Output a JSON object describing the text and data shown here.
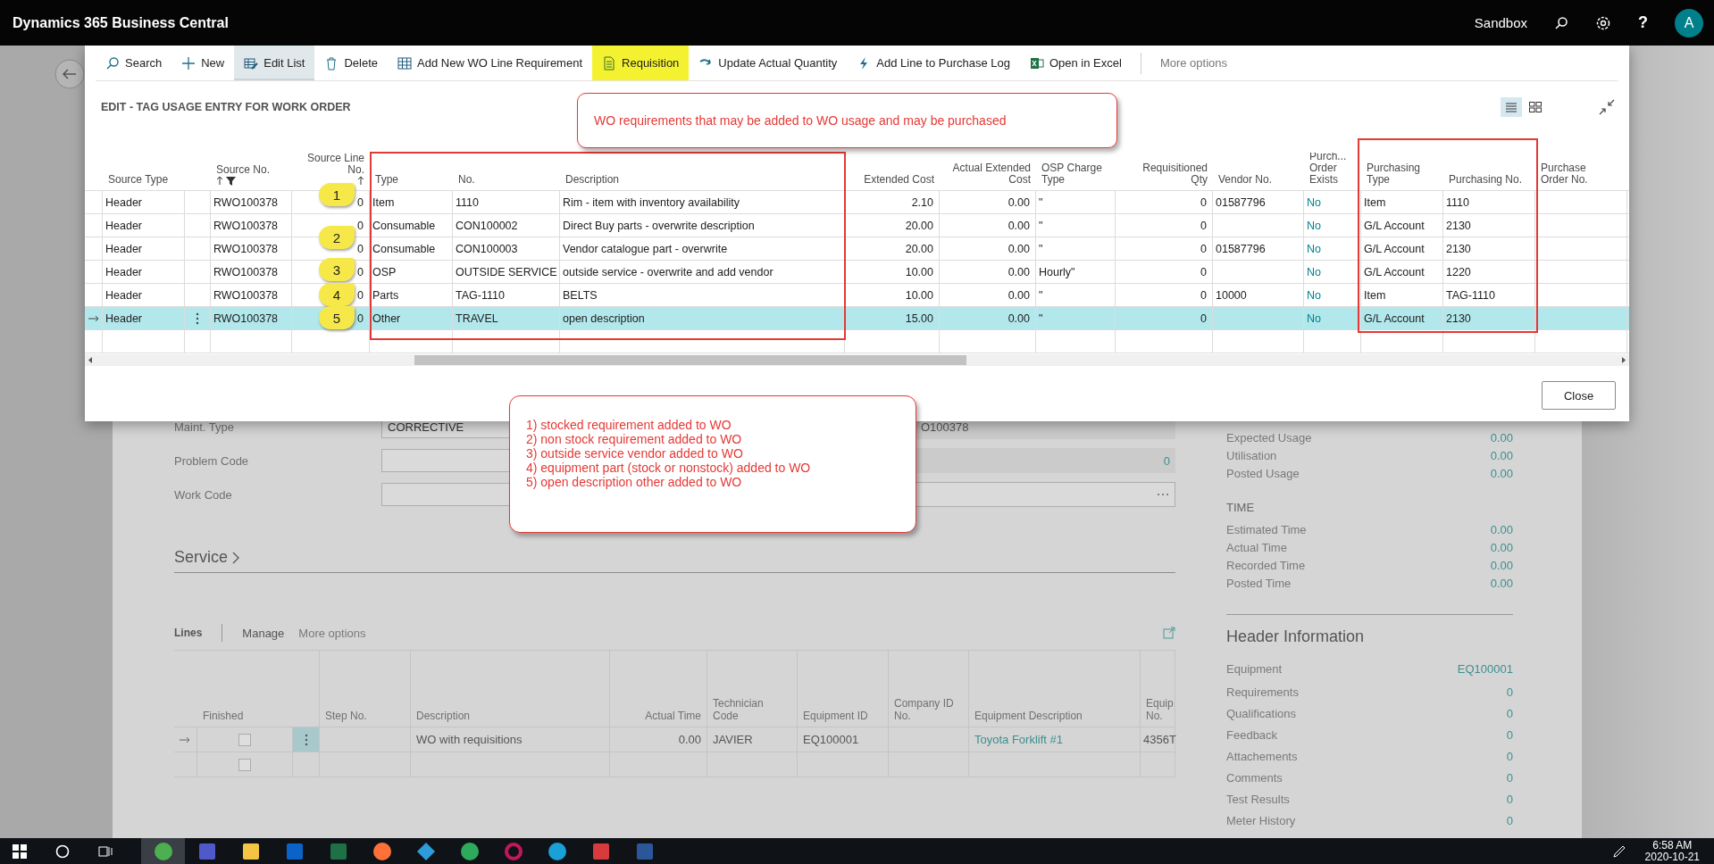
{
  "top_bar": {
    "title": "Dynamics 365 Business Central",
    "environment": "Sandbox",
    "help": "?",
    "avatar": "A"
  },
  "dialog": {
    "toolbar": [
      {
        "label": "Search",
        "selected": false,
        "highlighted": false
      },
      {
        "label": "New",
        "selected": false,
        "highlighted": false
      },
      {
        "label": "Edit List",
        "selected": true,
        "highlighted": false
      },
      {
        "label": "Delete",
        "selected": false,
        "highlighted": false
      },
      {
        "label": "Add New WO Line Requirement",
        "selected": false,
        "highlighted": false
      },
      {
        "label": "Requisition",
        "selected": false,
        "highlighted": true
      },
      {
        "label": "Update Actual Quantity",
        "selected": false,
        "highlighted": false
      },
      {
        "label": "Add Line to Purchase Log",
        "selected": false,
        "highlighted": false
      },
      {
        "label": "Open in Excel",
        "selected": false,
        "highlighted": false
      }
    ],
    "more_options": "More options",
    "title": "EDIT - TAG USAGE ENTRY FOR WORK ORDER",
    "columns": [
      {
        "lines": [
          "Source Type"
        ],
        "sorted": false,
        "filtered": false
      },
      {
        "lines": [
          "Source No."
        ],
        "sorted": true,
        "filtered": true
      },
      {
        "lines": [
          "Source Line",
          "No."
        ],
        "sorted": true,
        "filtered": false
      },
      {
        "lines": [
          "Type"
        ],
        "sorted": false,
        "filtered": false
      },
      {
        "lines": [
          "No."
        ],
        "sorted": false,
        "filtered": false
      },
      {
        "lines": [
          "Description"
        ],
        "sorted": false,
        "filtered": false
      },
      {
        "lines": [
          "Extended Cost"
        ],
        "sorted": false,
        "filtered": false
      },
      {
        "lines": [
          "Actual Extended",
          "Cost"
        ],
        "sorted": false,
        "filtered": false
      },
      {
        "lines": [
          "OSP Charge",
          "Type"
        ],
        "sorted": false,
        "filtered": false
      },
      {
        "lines": [
          "Requisitioned",
          "Qty"
        ],
        "sorted": false,
        "filtered": false
      },
      {
        "lines": [
          "Vendor No."
        ],
        "sorted": false,
        "filtered": false
      },
      {
        "lines": [
          "Purch...",
          "Order",
          "Exists"
        ],
        "sorted": false,
        "filtered": false
      },
      {
        "lines": [
          "Purchasing",
          "Type"
        ],
        "sorted": false,
        "filtered": false
      },
      {
        "lines": [
          "Purchasing No."
        ],
        "sorted": false,
        "filtered": false
      },
      {
        "lines": [
          "Purchase",
          "Order No."
        ],
        "sorted": false,
        "filtered": false
      }
    ],
    "rows": [
      {
        "selected": false,
        "source_type": "Header",
        "source_no": "RWO100378",
        "line_no": "0",
        "type": "Item",
        "no": "1110",
        "description": "Rim - item with inventory availability",
        "extended_cost": "2.10",
        "actual_extended_cost": "0.00",
        "osp_charge_type": "\"",
        "requisitioned_qty": "0",
        "vendor_no": "01587796",
        "po_exists": "No",
        "purchasing_type": "Item",
        "purchasing_no": "1110"
      },
      {
        "selected": false,
        "source_type": "Header",
        "source_no": "RWO100378",
        "line_no": "0",
        "type": "Consumable",
        "no": "CON100002",
        "description": "Direct Buy parts - overwrite description",
        "extended_cost": "20.00",
        "actual_extended_cost": "0.00",
        "osp_charge_type": "\"",
        "requisitioned_qty": "0",
        "po_exists": "No",
        "purchasing_type": "G/L Account",
        "purchasing_no": "2130"
      },
      {
        "selected": false,
        "source_type": "Header",
        "source_no": "RWO100378",
        "line_no": "0",
        "type": "Consumable",
        "no": "CON100003",
        "description": "Vendor catalogue part - overwrite",
        "extended_cost": "20.00",
        "actual_extended_cost": "0.00",
        "osp_charge_type": "\"",
        "requisitioned_qty": "0",
        "vendor_no": "01587796",
        "po_exists": "No",
        "purchasing_type": "G/L Account",
        "purchasing_no": "2130"
      },
      {
        "selected": false,
        "source_type": "Header",
        "source_no": "RWO100378",
        "line_no": "0",
        "type": "OSP",
        "no": "OUTSIDE SERVICE",
        "description": "outside service - overwrite and add vendor",
        "extended_cost": "10.00",
        "actual_extended_cost": "0.00",
        "osp_charge_type": "Hourly\"",
        "requisitioned_qty": "0",
        "po_exists": "No",
        "purchasing_type": "G/L Account",
        "purchasing_no": "1220"
      },
      {
        "selected": false,
        "source_type": "Header",
        "source_no": "RWO100378",
        "line_no": "0",
        "type": "Parts",
        "no": "TAG-1110",
        "description": "BELTS",
        "extended_cost": "10.00",
        "actual_extended_cost": "0.00",
        "osp_charge_type": "\"",
        "requisitioned_qty": "0",
        "vendor_no": "10000",
        "po_exists": "No",
        "purchasing_type": "Item",
        "purchasing_no": "TAG-1110"
      },
      {
        "selected": true,
        "source_type": "Header",
        "source_no": "RWO100378",
        "line_no": "0",
        "type": "Other",
        "no": "TRAVEL",
        "description": "open description",
        "extended_cost": "15.00",
        "actual_extended_cost": "0.00",
        "osp_charge_type": "\"",
        "requisitioned_qty": "0",
        "po_exists": "No",
        "purchasing_type": "G/L Account",
        "purchasing_no": "2130"
      }
    ],
    "close": "Close"
  },
  "annotations": {
    "top_note": "WO requirements that may be added to WO usage and may be purchased",
    "list_note": [
      "1) stocked requirement added to WO",
      "2) non stock requirement added to WO",
      "3) outside service vendor added to WO",
      "4) equipment part (stock or nonstock) added to WO",
      "5) open description other added to WO"
    ],
    "markers": [
      {
        "label": "1"
      },
      {
        "label": "2"
      },
      {
        "label": "3"
      },
      {
        "label": "4"
      },
      {
        "label": "5"
      }
    ]
  },
  "page": {
    "fields": [
      {
        "label": "Maint. Type",
        "value": "CORRECTIVE",
        "kind": "text",
        "right_value": "O100378"
      },
      {
        "label": "Problem Code",
        "kind": "number",
        "right_value": "0"
      },
      {
        "label": "Work Code",
        "kind": "lookup"
      }
    ],
    "service_title": "Service",
    "lines": {
      "title": "Lines",
      "actions": [
        "Manage",
        "More options"
      ],
      "columns": [
        {
          "lines": [
            "Finished"
          ]
        },
        {
          "lines": [
            "Step No."
          ]
        },
        {
          "lines": [
            "Description"
          ]
        },
        {
          "lines": [
            "Actual Time"
          ]
        },
        {
          "lines": [
            "Technician",
            "Code"
          ]
        },
        {
          "lines": [
            "Equipment ID"
          ]
        },
        {
          "lines": [
            "Company ID",
            "No."
          ]
        },
        {
          "lines": [
            "Equipment Description"
          ]
        },
        {
          "lines": [
            "Equip.",
            "No."
          ]
        }
      ],
      "rows": [
        {
          "selected": true,
          "finished": false,
          "description": "WO with requisitions",
          "actual_time": "0.00",
          "technician_code": "JAVIER",
          "equipment_id": "EQ100001",
          "equipment_description": "Toyota Forklift #1",
          "equipment_no": "4356T"
        },
        {
          "selected": false,
          "finished": false
        }
      ]
    },
    "factbox": {
      "usage": [
        {
          "label": "Expected Usage",
          "value": "0.00"
        },
        {
          "label": "Utilisation",
          "value": "0.00"
        },
        {
          "label": "Posted Usage",
          "value": "0.00"
        }
      ],
      "time_title": "TIME",
      "time": [
        {
          "label": "Estimated Time",
          "value": "0.00"
        },
        {
          "label": "Actual Time",
          "value": "0.00"
        },
        {
          "label": "Recorded Time",
          "value": "0.00"
        },
        {
          "label": "Posted Time",
          "value": "0.00"
        }
      ],
      "header_title": "Header Information",
      "header": [
        {
          "label": "Equipment",
          "value": "EQ100001"
        },
        {
          "label": "Requirements",
          "value": "0"
        },
        {
          "label": "Qualifications",
          "value": "0"
        },
        {
          "label": "Feedback",
          "value": "0"
        },
        {
          "label": "Attachements",
          "value": "0"
        },
        {
          "label": "Comments",
          "value": "0"
        },
        {
          "label": "Test Results",
          "value": "0"
        },
        {
          "label": "Meter History",
          "value": "0"
        }
      ]
    }
  },
  "taskbar": {
    "time": "6:58 AM",
    "date": "2020-10-21"
  }
}
